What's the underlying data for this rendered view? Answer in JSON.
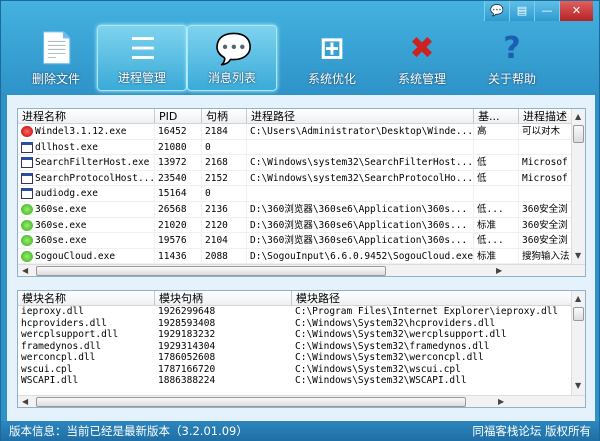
{
  "window": {
    "controls": [
      {
        "icon": "feedback-icon",
        "label": "💬"
      },
      {
        "icon": "menu-icon",
        "label": "▤"
      },
      {
        "icon": "minimize-icon",
        "label": "—"
      },
      {
        "icon": "close-icon",
        "label": "✕"
      }
    ]
  },
  "toolbar": [
    {
      "label": "删除文件",
      "icon": "delete-file-icon",
      "active": false
    },
    {
      "label": "进程管理",
      "icon": "process-list-icon",
      "active": true
    },
    {
      "label": "消息列表",
      "icon": "message-icon",
      "active": true
    },
    {
      "label": "系统优化",
      "icon": "windows-logo-icon",
      "active": false
    },
    {
      "label": "系统管理",
      "icon": "tools-icon",
      "active": false
    },
    {
      "label": "关于帮助",
      "icon": "help-icon",
      "active": false
    }
  ],
  "process_table": {
    "headers": [
      "进程名称",
      "PID",
      "句柄",
      "进程路径",
      "基...",
      "进程描述"
    ],
    "rows": [
      [
        "Windel3.1.12.exe",
        "16452",
        "2184",
        "C:\\Users\\Administrator\\Desktop\\Winde...",
        "高",
        "可以对木"
      ],
      [
        "dllhost.exe",
        "21080",
        "0",
        "",
        "",
        ""
      ],
      [
        "SearchFilterHost.exe",
        "13972",
        "2168",
        "C:\\Windows\\system32\\SearchFilterHost...",
        "低",
        "Microsof"
      ],
      [
        "SearchProtocolHost...",
        "23540",
        "2152",
        "C:\\Windows\\system32\\SearchProtocolHo...",
        "低",
        "Microsof"
      ],
      [
        "audiodg.exe",
        "15164",
        "0",
        "",
        "",
        ""
      ],
      [
        "360se.exe",
        "26568",
        "2136",
        "D:\\360浏览器\\360se6\\Application\\360s...",
        "低...",
        "360安全浏"
      ],
      [
        "360se.exe",
        "21020",
        "2120",
        "D:\\360浏览器\\360se6\\Application\\360s...",
        "标准",
        "360安全浏"
      ],
      [
        "360se.exe",
        "19576",
        "2104",
        "D:\\360浏览器\\360se6\\Application\\360s...",
        "低...",
        "360安全浏"
      ],
      [
        "SogouCloud.exe",
        "11436",
        "2088",
        "D:\\SogouInput\\6.6.0.9452\\SogouCloud.exe",
        "标准",
        "搜狗输入法"
      ]
    ],
    "icons": [
      "red",
      "win",
      "win",
      "win",
      "win",
      "green",
      "green",
      "green",
      "green"
    ]
  },
  "module_table": {
    "headers": [
      "模块名称",
      "模块句柄",
      "模块路径"
    ],
    "rows": [
      [
        "ieproxy.dll",
        "1926299648",
        "C:\\Program Files\\Internet Explorer\\ieproxy.dll"
      ],
      [
        "hcproviders.dll",
        "1928593408",
        "C:\\Windows\\System32\\hcproviders.dll"
      ],
      [
        "wercplsupport.dll",
        "1929183232",
        "C:\\Windows\\System32\\wercplsupport.dll"
      ],
      [
        "framedynos.dll",
        "1929314304",
        "C:\\Windows\\System32\\framedynos.dll"
      ],
      [
        "werconcpl.dll",
        "1786052608",
        "C:\\Windows\\System32\\werconcpl.dll"
      ],
      [
        "wscui.cpl",
        "1787166720",
        "C:\\Windows\\System32\\wscui.cpl"
      ],
      [
        "WSCAPI.dll",
        "1886388224",
        "C:\\Windows\\System32\\WSCAPI.dll"
      ]
    ]
  },
  "status": {
    "version": "版本信息：当前已经是最新版本（3.2.01.09）",
    "copyright": "同福客栈论坛 版权所有"
  }
}
